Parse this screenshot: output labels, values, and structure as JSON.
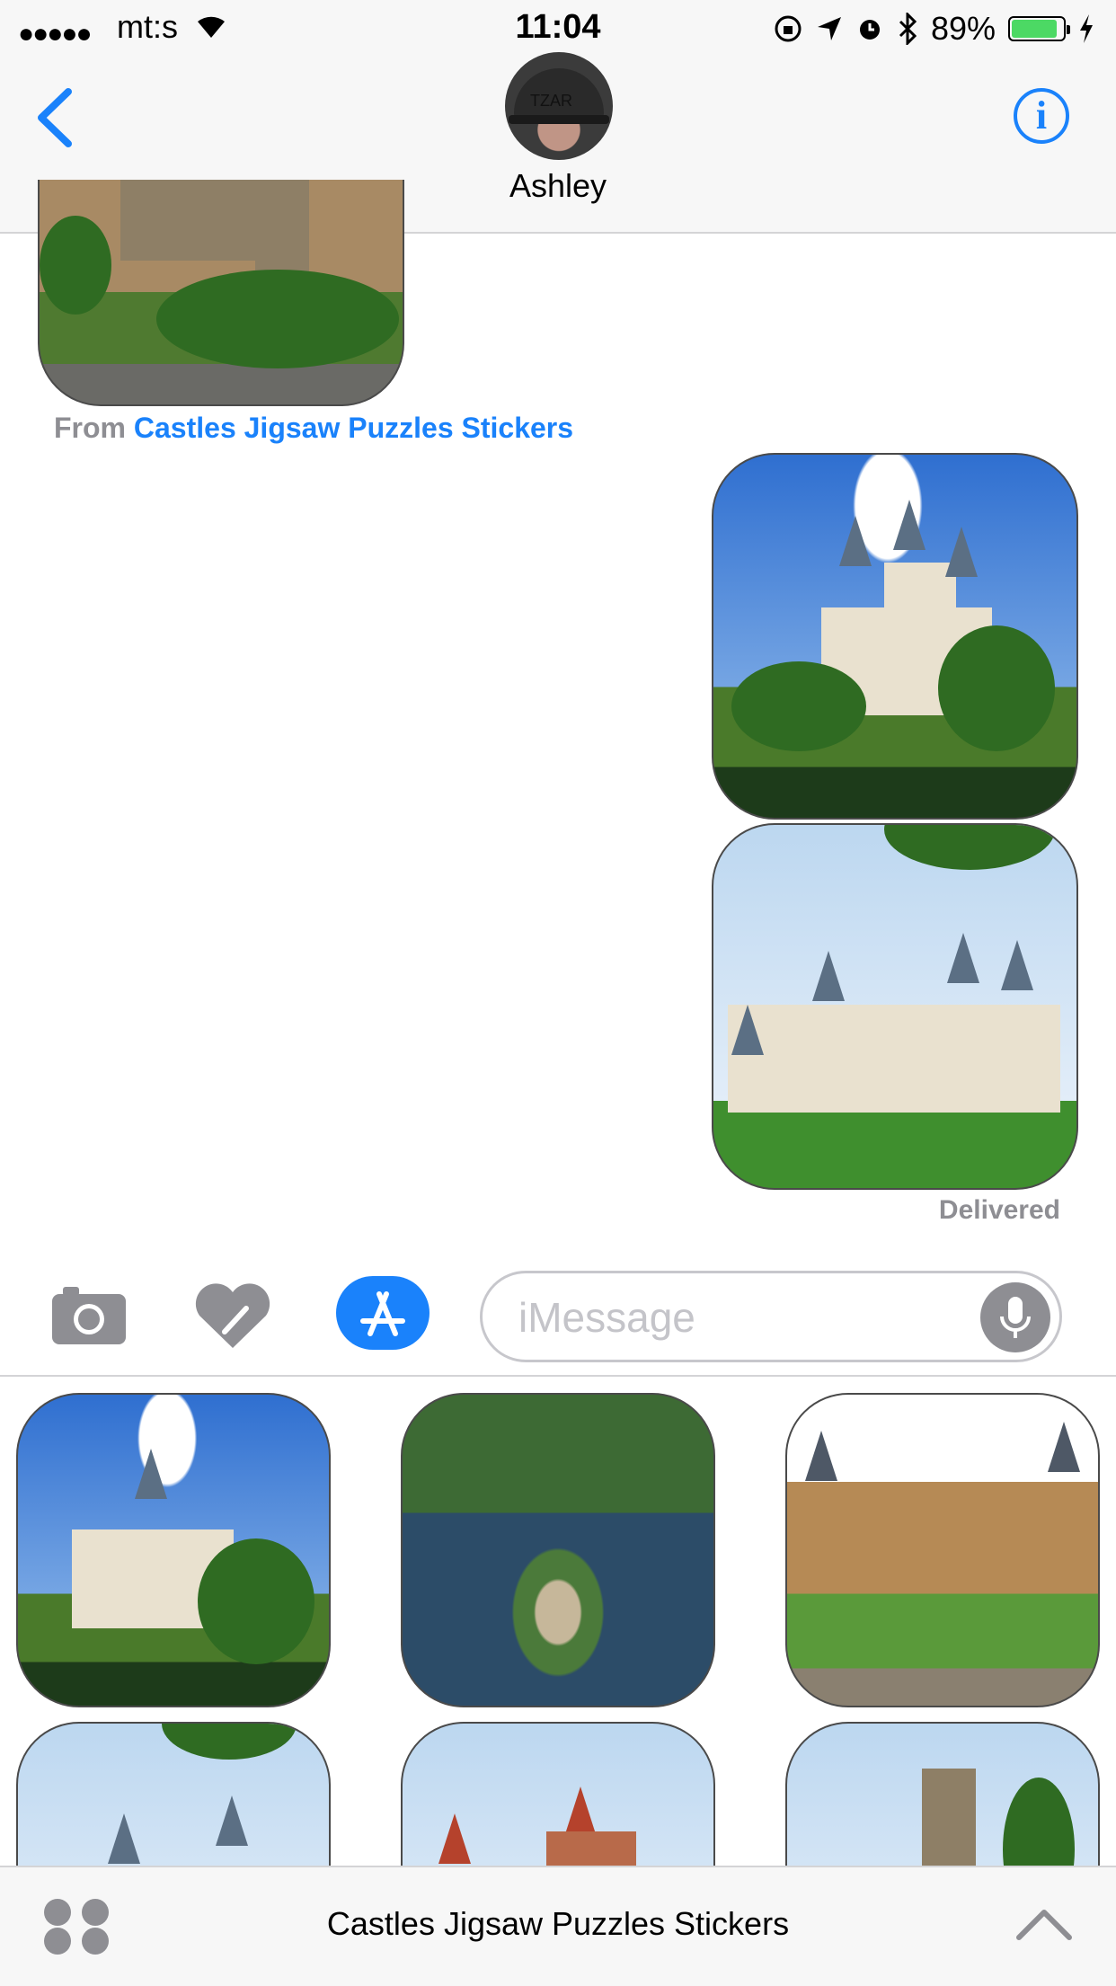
{
  "status_bar": {
    "carrier": "mt:s",
    "time": "11:04",
    "battery": "89%",
    "battery_level": 0.89
  },
  "nav": {
    "contact_name": "Ashley",
    "back_icon": "chevron-left-icon",
    "info_icon": "info-icon",
    "avatar_text": "TZAR"
  },
  "conversation": {
    "from_prefix": "From",
    "from_app": "Castles Jigsaw Puzzles Stickers",
    "delivered": "Delivered"
  },
  "input": {
    "placeholder": "iMessage"
  },
  "drawer": {
    "title": "Castles Jigsaw Puzzles Stickers"
  },
  "colors": {
    "accent": "#1a82fb",
    "battery": "#4cd964",
    "secondary_text": "#8e8e93"
  }
}
